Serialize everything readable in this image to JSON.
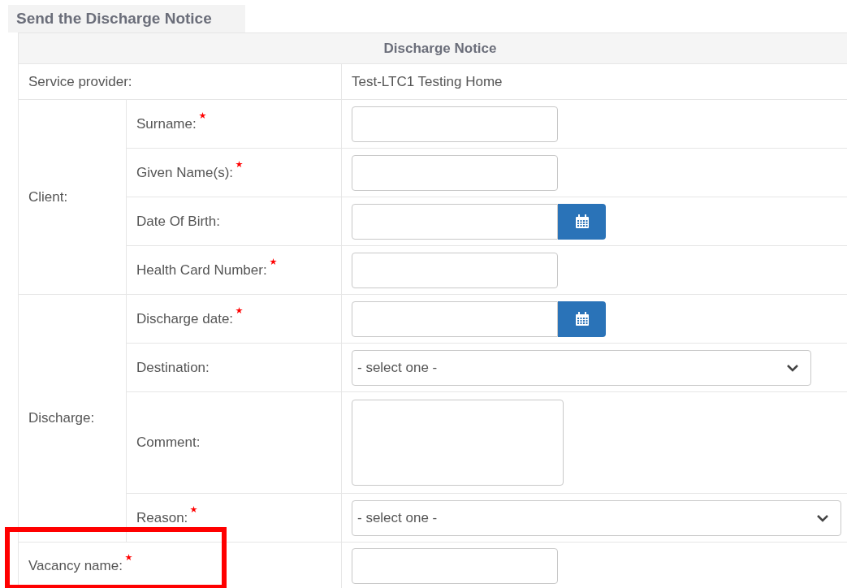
{
  "title": "Send the Discharge Notice",
  "table": {
    "heading": "Discharge Notice",
    "rows": [
      {
        "kind": "info",
        "label": "Service provider:",
        "value": "Test-LTC1 Testing Home"
      },
      {
        "kind": "group",
        "label": "Client:",
        "fields": [
          {
            "label": "Surname:",
            "required": true,
            "kind": "input"
          },
          {
            "label": "Given Name(s):",
            "required": true,
            "kind": "input"
          },
          {
            "label": "Date Of Birth:",
            "required": false,
            "kind": "date"
          },
          {
            "label": "Health Card Number:",
            "required": true,
            "kind": "input"
          }
        ]
      },
      {
        "kind": "group",
        "label": "Discharge:",
        "fields": [
          {
            "label": "Discharge date:",
            "required": true,
            "kind": "date"
          },
          {
            "label": "Destination:",
            "required": false,
            "kind": "select",
            "value": "- select one -",
            "wide": false
          },
          {
            "label": "Comment:",
            "required": false,
            "kind": "textarea"
          },
          {
            "label": "Reason:",
            "required": true,
            "kind": "select",
            "value": "- select one -",
            "wide": true
          }
        ]
      },
      {
        "kind": "single",
        "highlighted": true,
        "fields": [
          {
            "label": "Vacancy name:",
            "required": true,
            "kind": "input"
          }
        ]
      }
    ]
  }
}
